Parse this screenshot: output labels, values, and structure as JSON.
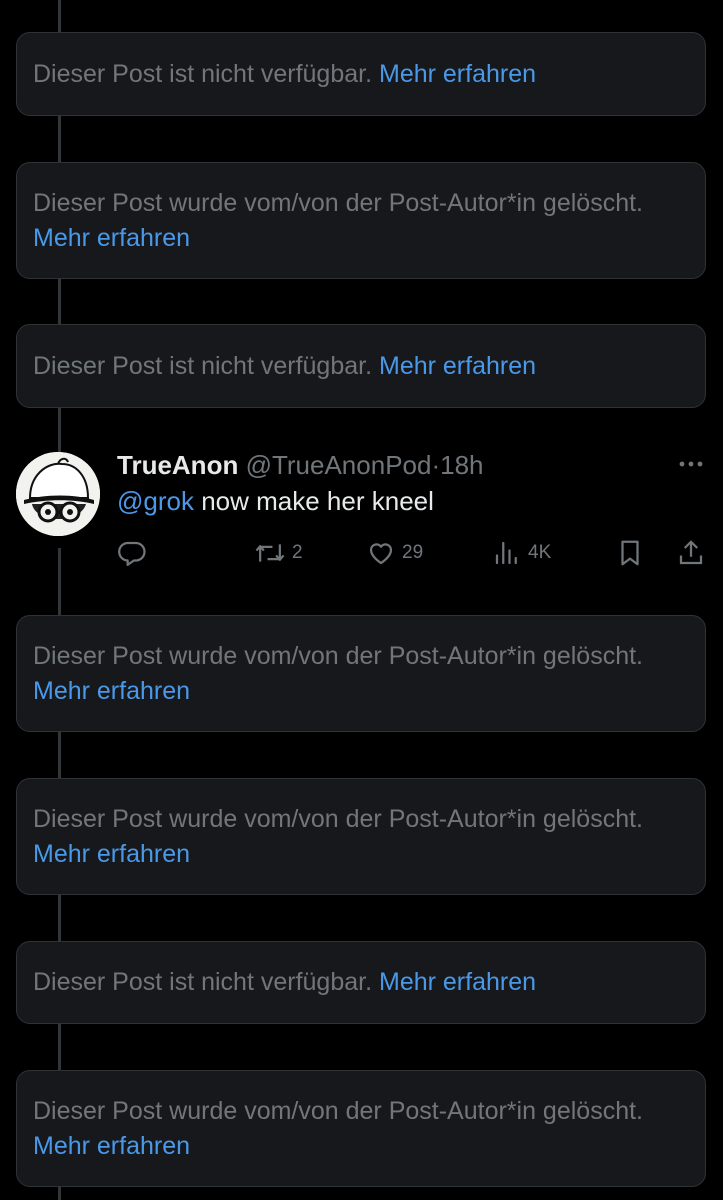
{
  "notice_link": "Mehr erfahren",
  "notices": [
    {
      "text": "Dieser Post ist nicht verfügbar.",
      "link": "Mehr erfahren"
    },
    {
      "text": "Dieser Post wurde vom/von der Post-Autor*in gelöscht.",
      "link": "Mehr erfahren"
    },
    {
      "text": "Dieser Post ist nicht verfügbar.",
      "link": "Mehr erfahren"
    },
    {
      "text": "Dieser Post wurde vom/von der Post-Autor*in gelöscht.",
      "link": "Mehr erfahren"
    },
    {
      "text": "Dieser Post wurde vom/von der Post-Autor*in gelöscht.",
      "link": "Mehr erfahren"
    },
    {
      "text": "Dieser Post ist nicht verfügbar.",
      "link": "Mehr erfahren"
    },
    {
      "text": "Dieser Post wurde vom/von der Post-Autor*in gelöscht.",
      "link": "Mehr erfahren"
    }
  ],
  "tweet": {
    "display_name": "TrueAnon",
    "handle": "@TrueAnonPod",
    "separator": "·",
    "time": "18h",
    "mention": "@grok",
    "text": " now make her kneel",
    "reposts": "2",
    "likes": "29",
    "views": "4K"
  },
  "colors": {
    "background": "#000000",
    "card": "#16181c",
    "link": "#4a99e9",
    "muted": "#71767b",
    "text": "#e7e9ea"
  },
  "icons": [
    "reply-icon",
    "repost-icon",
    "like-icon",
    "views-icon",
    "bookmark-icon",
    "share-icon",
    "more-icon"
  ]
}
